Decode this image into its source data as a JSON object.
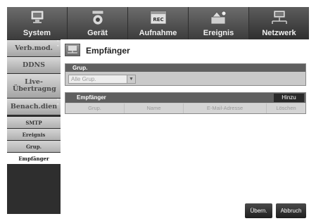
{
  "tabs": [
    {
      "label": "System",
      "icon": "monitor-icon"
    },
    {
      "label": "Gerät",
      "icon": "camera-icon"
    },
    {
      "label": "Aufnahme",
      "icon": "rec-calendar-icon"
    },
    {
      "label": "Ereignis",
      "icon": "event-icon"
    },
    {
      "label": "Netzwerk",
      "icon": "network-icon"
    }
  ],
  "active_tab": "Netzwerk",
  "sidebar": {
    "items": [
      {
        "label": "Verb.mod."
      },
      {
        "label": "DDNS"
      },
      {
        "label": "Live-Übertragng"
      },
      {
        "label": "Benach.dien"
      }
    ],
    "sub_items": [
      {
        "label": "SMTP"
      },
      {
        "label": "Ereignis"
      },
      {
        "label": "Grup."
      },
      {
        "label": "Empfänger"
      }
    ]
  },
  "page": {
    "title": "Empfänger"
  },
  "group_section": {
    "header": "Grup.",
    "select_value": "Alle Grup."
  },
  "recipients_section": {
    "header": "Empfänger",
    "add_button": "Hinzu",
    "columns": [
      "Grup.",
      "Name",
      "E-Mail-Adresse",
      "Löschen"
    ]
  },
  "footer": {
    "apply": "Übern.",
    "cancel": "Abbruch"
  }
}
